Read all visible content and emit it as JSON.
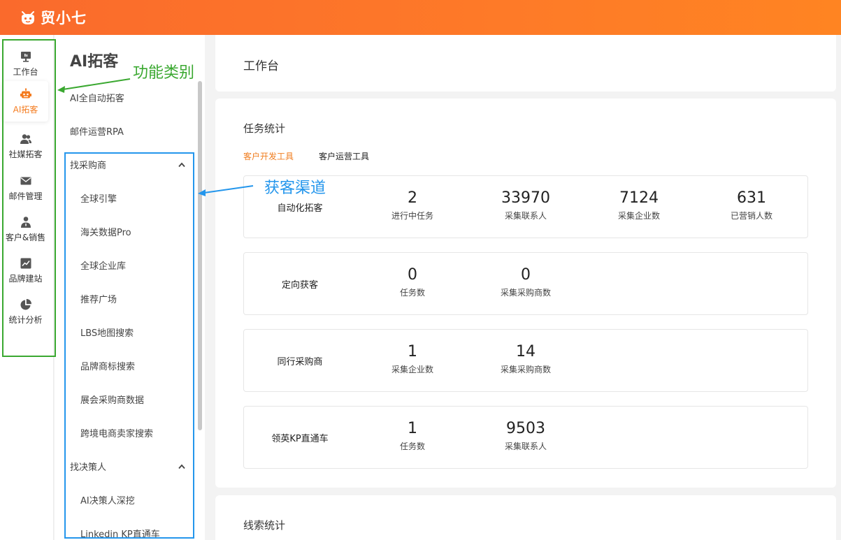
{
  "app": {
    "name": "贸小七",
    "icon": "robot-logo-icon"
  },
  "rail": {
    "items": [
      {
        "label": "工作台",
        "icon": "monitor-icon",
        "active": false
      },
      {
        "label": "AI拓客",
        "icon": "robot-icon",
        "active": true
      },
      {
        "label": "社媒拓客",
        "icon": "users-icon",
        "active": false
      },
      {
        "label": "邮件管理",
        "icon": "mail-icon",
        "active": false
      },
      {
        "label": "客户&销售",
        "icon": "person-icon",
        "active": false
      },
      {
        "label": "品牌建站",
        "icon": "chart-line-icon",
        "active": false
      },
      {
        "label": "统计分析",
        "icon": "pie-chart-icon",
        "active": false
      }
    ],
    "active_color": "#f47c20"
  },
  "subnav": {
    "title": "AI拓客",
    "items": [
      "AI全自动拓客",
      "邮件运营RPA"
    ],
    "groups": [
      {
        "label": "找采购商",
        "expanded": true,
        "children": [
          "全球引擎",
          "海关数据Pro",
          "全球企业库",
          "推荐广场",
          "LBS地图搜索",
          "品牌商标搜索",
          "展会采购商数据",
          "跨境电商卖家搜索"
        ]
      },
      {
        "label": "找决策人",
        "expanded": true,
        "children": [
          "AI决策人深挖",
          "Linkedin KP直通车"
        ]
      }
    ]
  },
  "header": {
    "title": "工作台"
  },
  "stats": {
    "title": "任务统计",
    "tabs": [
      {
        "label": "客户开发工具",
        "active": true
      },
      {
        "label": "客户运营工具",
        "active": false
      }
    ],
    "rows": [
      {
        "name": "自动化拓客",
        "metrics": [
          {
            "value": "2",
            "label": "进行中任务"
          },
          {
            "value": "33970",
            "label": "采集联系人"
          },
          {
            "value": "7124",
            "label": "采集企业数"
          },
          {
            "value": "631",
            "label": "已营销人数"
          }
        ]
      },
      {
        "name": "定向获客",
        "metrics": [
          {
            "value": "0",
            "label": "任务数"
          },
          {
            "value": "0",
            "label": "采集采购商数"
          }
        ]
      },
      {
        "name": "同行采购商",
        "metrics": [
          {
            "value": "1",
            "label": "采集企业数"
          },
          {
            "value": "14",
            "label": "采集采购商数"
          }
        ]
      },
      {
        "name": "领英KP直通车",
        "metrics": [
          {
            "value": "1",
            "label": "任务数"
          },
          {
            "value": "9503",
            "label": "采集联系人"
          }
        ]
      }
    ]
  },
  "clues": {
    "title": "线索统计"
  },
  "annotations": {
    "function_category": "功能类别",
    "acquisition_channel": "获客渠道",
    "green_color": "#3aa830",
    "blue_color": "#2496ec"
  },
  "colors": {
    "brand": "#fa6a2c",
    "accent": "#f07d1f"
  }
}
